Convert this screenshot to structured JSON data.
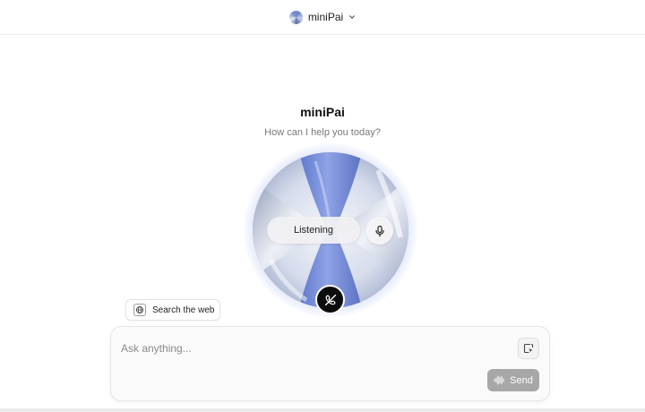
{
  "header": {
    "model_name": "miniPai",
    "logo_icon": "orb-logo-icon",
    "dropdown_icon": "chevron-down-icon"
  },
  "hero": {
    "title": "miniPai",
    "subtitle": "How can I help you today?"
  },
  "voice": {
    "status_label": "Listening",
    "mic_icon": "microphone-icon",
    "end_icon": "phone-off-icon",
    "orb_colors": [
      "#7d93db",
      "#e9edf6",
      "#b9c3e0"
    ]
  },
  "tools": {
    "search_label": "Search the web",
    "search_icon": "globe-icon"
  },
  "composer": {
    "placeholder": "Ask anything...",
    "attach_icon": "attach-icon",
    "send_label": "Send",
    "send_icon": "waveform-icon",
    "send_color": "#a7a7a7"
  }
}
